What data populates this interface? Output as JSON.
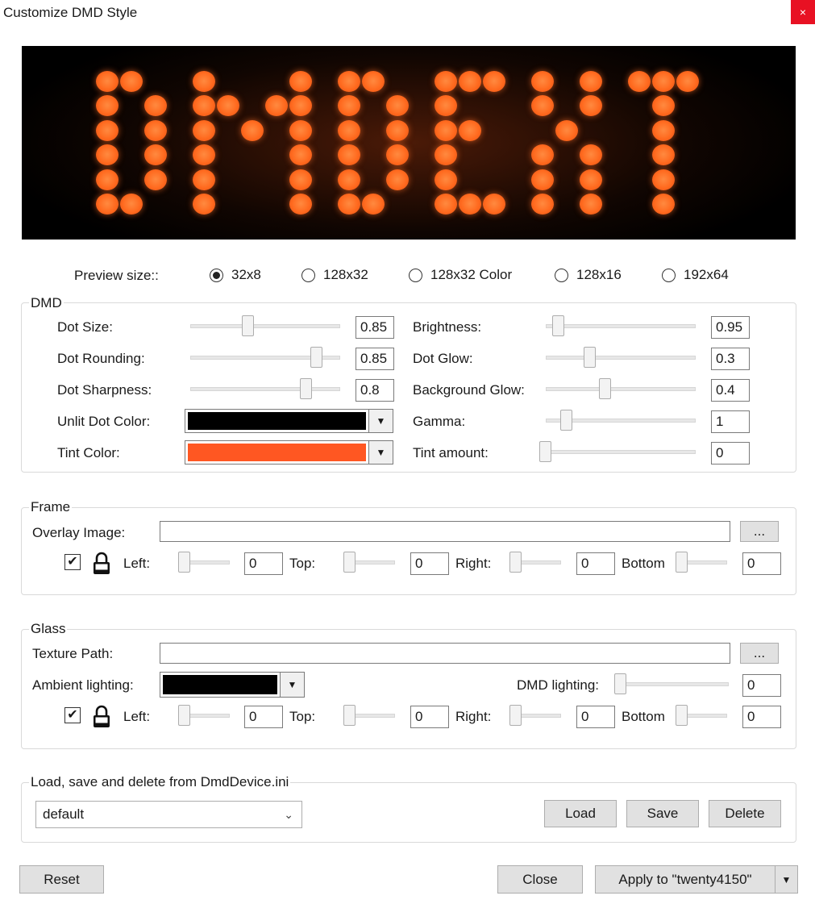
{
  "window": {
    "title": "Customize DMD Style",
    "close_icon": "×"
  },
  "preview": {
    "text": "DMDEXT",
    "dot_color": "#ff6a1f"
  },
  "preview_size": {
    "label": "Preview size::",
    "options": [
      "32x8",
      "128x32",
      "128x32 Color",
      "128x16",
      "192x64"
    ],
    "selected": "32x8"
  },
  "dmd": {
    "title": "DMD",
    "dot_size": {
      "label": "Dot Size:",
      "value": "0.85"
    },
    "dot_rounding": {
      "label": "Dot Rounding:",
      "value": "0.85"
    },
    "dot_sharpness": {
      "label": "Dot Sharpness:",
      "value": "0.8"
    },
    "unlit_dot_color": {
      "label": "Unlit Dot Color:",
      "color": "#000000"
    },
    "tint_color": {
      "label": "Tint Color:",
      "color": "#ff5722"
    },
    "brightness": {
      "label": "Brightness:",
      "value": "0.95"
    },
    "dot_glow": {
      "label": "Dot Glow:",
      "value": "0.3"
    },
    "background_glow": {
      "label": "Background Glow:",
      "value": "0.4"
    },
    "gamma": {
      "label": "Gamma:",
      "value": "1"
    },
    "tint_amount": {
      "label": "Tint amount:",
      "value": "0"
    }
  },
  "frame": {
    "title": "Frame",
    "overlay_label": "Overlay Image:",
    "overlay_value": "",
    "browse_label": "...",
    "checked": true,
    "left": {
      "label": "Left:",
      "value": "0"
    },
    "top": {
      "label": "Top:",
      "value": "0"
    },
    "right": {
      "label": "Right:",
      "value": "0"
    },
    "bottom": {
      "label": "Bottom",
      "value": "0"
    }
  },
  "glass": {
    "title": "Glass",
    "texture_label": "Texture Path:",
    "texture_value": "",
    "browse_label": "...",
    "ambient_label": "Ambient lighting:",
    "ambient_color": "#000000",
    "dmd_lighting_label": "DMD lighting:",
    "dmd_lighting_value": "0",
    "checked": true,
    "left": {
      "label": "Left:",
      "value": "0"
    },
    "top": {
      "label": "Top:",
      "value": "0"
    },
    "right": {
      "label": "Right:",
      "value": "0"
    },
    "bottom": {
      "label": "Bottom",
      "value": "0"
    }
  },
  "ini": {
    "title": "Load, save and delete from DmdDevice.ini",
    "selected": "default",
    "load": "Load",
    "save": "Save",
    "delete": "Delete"
  },
  "footer": {
    "reset": "Reset",
    "close": "Close",
    "apply": "Apply to \"twenty4150\""
  }
}
